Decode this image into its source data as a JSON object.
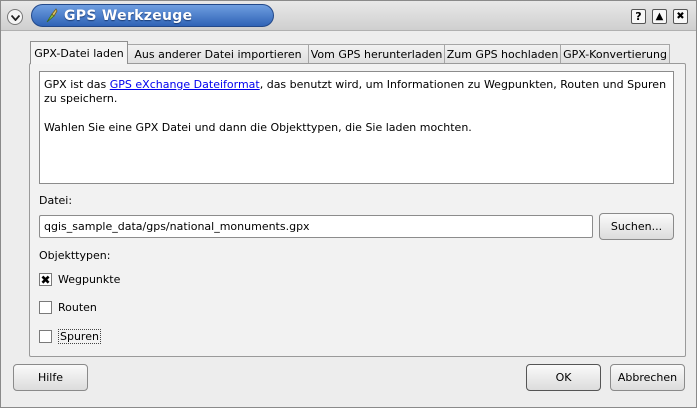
{
  "window": {
    "title": "GPS Werkzeuge",
    "accent": "#3a6fc4"
  },
  "titlebar_buttons": [
    {
      "icon": "help-icon",
      "glyph": "?"
    },
    {
      "icon": "shade-icon",
      "glyph": "▲"
    },
    {
      "icon": "close-icon",
      "glyph": "✖"
    }
  ],
  "tabs": [
    {
      "label": "GPX-Datei laden",
      "active": true
    },
    {
      "label": "Aus anderer Datei importieren",
      "active": false
    },
    {
      "label": "Vom GPS herunterladen",
      "active": false
    },
    {
      "label": "Zum GPS hochladen",
      "active": false
    },
    {
      "label": "GPX-Konvertierung",
      "active": false
    }
  ],
  "info": {
    "line1_prefix": "GPX ist das ",
    "line1_link": "GPS eXchange Dateiformat",
    "line1_suffix": ", das benutzt wird, um Informationen zu Wegpunkten, Routen und Spuren zu speichern.",
    "line2": "Wahlen Sie eine GPX Datei und dann die Objekttypen, die Sie laden mochten."
  },
  "file": {
    "label": "Datei:",
    "value": "qgis_sample_data/gps/national_monuments.gpx",
    "browse_label": "Suchen..."
  },
  "feature_types": {
    "label": "Objekttypen:",
    "items": [
      {
        "label": "Wegpunkte",
        "checked": true
      },
      {
        "label": "Routen",
        "checked": false
      },
      {
        "label": "Spuren",
        "checked": false
      }
    ]
  },
  "buttons": {
    "help": "Hilfe",
    "ok": "OK",
    "cancel": "Abbrechen"
  }
}
